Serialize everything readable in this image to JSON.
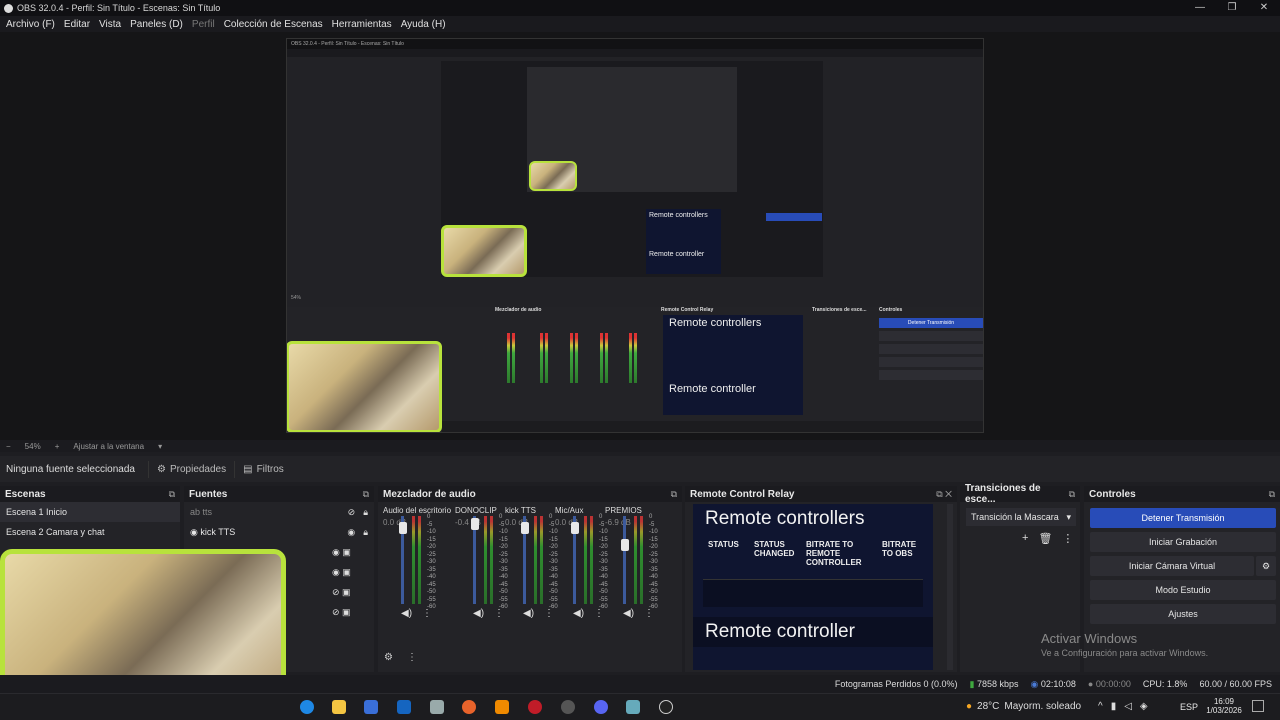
{
  "window": {
    "title": "OBS 32.0.4 - Perfil: Sin Título - Escenas: Sin Título",
    "controls": [
      "—",
      "❐",
      "✕"
    ]
  },
  "menu": [
    {
      "label": "Archivo (F)"
    },
    {
      "label": "Editar"
    },
    {
      "label": "Vista"
    },
    {
      "label": "Paneles (D)"
    },
    {
      "label": "Perfil",
      "disabled": true
    },
    {
      "label": "Colección de Escenas"
    },
    {
      "label": "Herramientas"
    },
    {
      "label": "Ayuda (H)"
    }
  ],
  "preview": {
    "zoom": "54%",
    "fit": "Ajustar a la ventana",
    "nested_title": "OBS 32.0.4 - Perfil: Sin Título - Escenas: Sin Título",
    "nested_remote_controllers": "Remote controllers",
    "nested_remote_controller": "Remote controller",
    "nested_relay": "Remote Control Relay",
    "nested_mixer": "Mezclador de audio",
    "nested_transitions": "Transiciones de esce...",
    "nested_controls": "Controles",
    "nested_stream_btn": "Detener Transmisión"
  },
  "context": {
    "no_source": "Ninguna fuente seleccionada",
    "properties": "Propiedades",
    "filters": "Filtros"
  },
  "scenes": {
    "title": "Escenas",
    "items": [
      "Escena 1 Inicio",
      "Escena 2  Camara y chat"
    ]
  },
  "sources": {
    "title": "Fuentes",
    "items": [
      {
        "label": "tts",
        "icon": "text-icon"
      },
      {
        "label": "kick  TTS",
        "icon": "browser-icon"
      }
    ]
  },
  "mixer": {
    "title": "Mezclador de audio",
    "channels": [
      {
        "name": "Audio del escritorio",
        "db": "0.0 dB",
        "level": 0.92
      },
      {
        "name": "DONOCLIP",
        "db": "-0.4 dB",
        "level": 0.98
      },
      {
        "name": "kick  TTS",
        "db": "0.0 dB",
        "level": 0.92
      },
      {
        "name": "Mic/Aux",
        "db": "0.0 dB",
        "level": 0.92
      },
      {
        "name": "PREMIOS",
        "db": "-6.9 dB",
        "level": 0.7
      }
    ],
    "scale": [
      "0",
      "-5",
      "-10",
      "-15",
      "-20",
      "-25",
      "-30",
      "-35",
      "-40",
      "-45",
      "-50",
      "-55",
      "-60"
    ]
  },
  "relay": {
    "title": "Remote Control Relay",
    "heading1": "Remote controllers",
    "cols": [
      "STATUS",
      "STATUS CHANGED",
      "BITRATE TO REMOTE CONTROLLER",
      "BITRATE TO OBS"
    ],
    "heading2": "Remote controller"
  },
  "transitions": {
    "title": "Transiciones de esce...",
    "selected": "Transición la Mascara"
  },
  "controls": {
    "title": "Controles",
    "buttons": [
      "Detener Transmisión",
      "Iniciar Grabación",
      "Iniciar Cámara Virtual",
      "Modo Estudio",
      "Ajustes"
    ]
  },
  "watermark": {
    "line1": "Activar Windows",
    "line2": "Ve a Configuración para activar Windows."
  },
  "status": {
    "dropped": "Fotogramas Perdidos 0 (0.0%)",
    "kbps": "7858 kbps",
    "stream_time": "02:10:08",
    "rec_time": "00:00:00",
    "cpu": "CPU: 1.8%",
    "fps": "60.00 / 60.00 FPS"
  },
  "taskbar": {
    "weather_temp": "28°C",
    "weather_text": "Mayorm. soleado",
    "lang": "ESP",
    "time": "16:09",
    "date": "1/03/2026"
  },
  "colors": {
    "accent": "#284cb8",
    "meter_green": "#3fa83f",
    "cam_border": "#b8e23c"
  }
}
